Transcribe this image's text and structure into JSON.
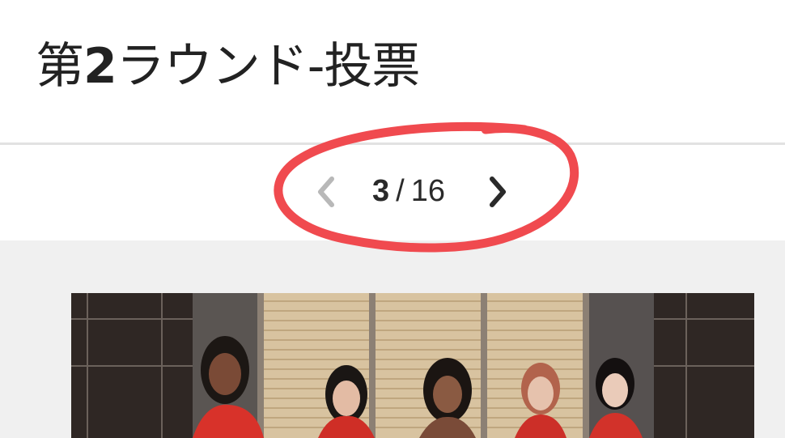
{
  "header": {
    "title_prefix": "第",
    "title_number": "2",
    "title_suffix": "ラウンド-投票"
  },
  "pager": {
    "current": "3",
    "separator": "/",
    "total": "16",
    "prev_icon": "chevron-left-icon",
    "next_icon": "chevron-right-icon",
    "prev_enabled": false,
    "next_enabled": true
  },
  "colors": {
    "annotation": "#f04a4f",
    "disabled_arrow": "#b8b8b8",
    "active_arrow": "#2a2a2a",
    "content_bg": "#f0f0f0"
  },
  "photo": {
    "subject": "group-photo",
    "people_visible": 5
  }
}
